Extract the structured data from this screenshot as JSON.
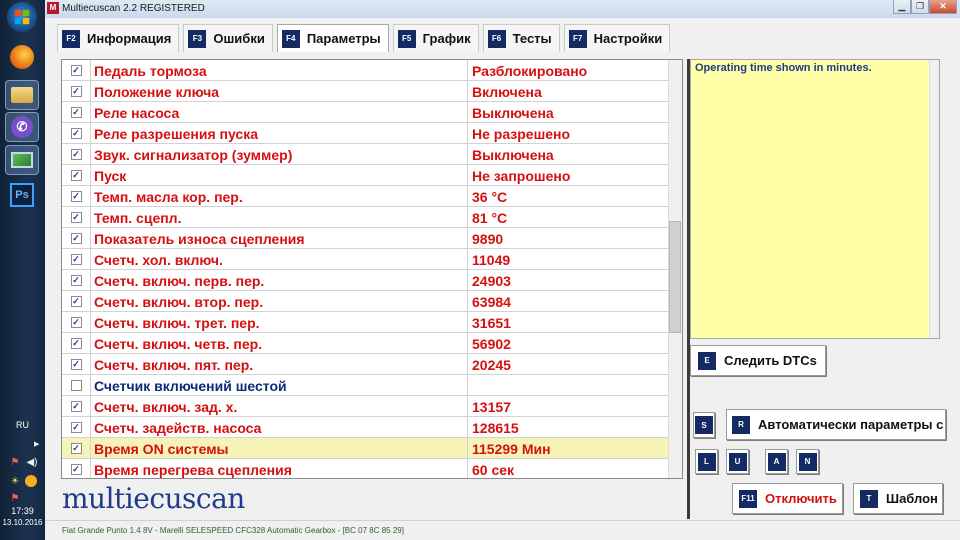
{
  "window": {
    "title": "Multiecuscan 2.2 REGISTERED"
  },
  "taskbar": {
    "language": "RU",
    "time": "17:39",
    "date": "13.10.2016",
    "ps_label": "Ps"
  },
  "tabs": [
    {
      "key": "F2",
      "label": "Информация"
    },
    {
      "key": "F3",
      "label": "Ошибки"
    },
    {
      "key": "F4",
      "label": "Параметры",
      "active": true
    },
    {
      "key": "F5",
      "label": "График"
    },
    {
      "key": "F6",
      "label": "Тесты"
    },
    {
      "key": "F7",
      "label": "Настройки"
    }
  ],
  "params": [
    {
      "name": "Педаль тормоза",
      "value": "Разблокировано",
      "checked": true
    },
    {
      "name": "Положение ключа",
      "value": "Включена",
      "checked": true
    },
    {
      "name": "Реле насоса",
      "value": "Выключена",
      "checked": true
    },
    {
      "name": "Реле разрешения пуска",
      "value": "Не разрешено",
      "checked": true
    },
    {
      "name": "Звук. сигнализатор (зуммер)",
      "value": "Выключена",
      "checked": true
    },
    {
      "name": "Пуск",
      "value": "Не запрошено",
      "checked": true
    },
    {
      "name": "Темп. масла кор. пер.",
      "value": "36 °C",
      "checked": true
    },
    {
      "name": "Темп. сцепл.",
      "value": "81 °C",
      "checked": true
    },
    {
      "name": "Показатель износа сцепления",
      "value": "9890",
      "checked": true
    },
    {
      "name": "Счетч. хол. включ.",
      "value": "11049",
      "checked": true
    },
    {
      "name": "Счетч. включ. перв. пер.",
      "value": "24903",
      "checked": true
    },
    {
      "name": "Счетч. включ. втор. пер.",
      "value": "63984",
      "checked": true
    },
    {
      "name": "Счетч. включ. трет. пер.",
      "value": "31651",
      "checked": true
    },
    {
      "name": "Счетч. включ. четв. пер.",
      "value": "56902",
      "checked": true
    },
    {
      "name": "Счетч. включ. пят. пер.",
      "value": "20245",
      "checked": true
    },
    {
      "name": "Счетчик включений шестой",
      "value": "",
      "checked": false
    },
    {
      "name": "Счетч. включ. зад. х.",
      "value": "13157",
      "checked": true
    },
    {
      "name": "Счетч. задейств. насоса",
      "value": "128615",
      "checked": true
    },
    {
      "name": "Время ON системы",
      "value": "115299 Мин",
      "checked": true,
      "highlighted": true
    },
    {
      "name": "Время перегрева сцепления",
      "value": "60 сек",
      "checked": true
    }
  ],
  "info": {
    "text": "Operating time shown in minutes."
  },
  "buttons": {
    "watch_dtc": {
      "key": "E",
      "label": "Следить DTCs"
    },
    "s": {
      "key": "S"
    },
    "auto_params": {
      "key": "R",
      "label": "Автоматически параметры с"
    },
    "l": {
      "key": "L"
    },
    "u": {
      "key": "U"
    },
    "a": {
      "key": "A"
    },
    "n": {
      "key": "N"
    },
    "disconnect": {
      "key": "F11",
      "label": "Отключить"
    },
    "template": {
      "key": "T",
      "label": "Шаблон"
    }
  },
  "logo": "multiecuscan",
  "status": "Fiat Grande Punto 1.4 8V - Marelli SELESPEED CFC328 Automatic Gearbox - [BC 07 8C 85 29]",
  "colors": {
    "param_text": "#d41010",
    "disabled_text": "#0f2a78",
    "key_badge": "#132a63",
    "highlight_row": "#f6f3b8",
    "info_bg": "#ffffa8"
  },
  "icons": [
    "windows-start-icon",
    "firefox-icon",
    "folder-icon",
    "viber-icon",
    "monitor-icon",
    "photoshop-icon",
    "flag-icon",
    "volume-icon",
    "brightness-icon",
    "clock-icon"
  ]
}
